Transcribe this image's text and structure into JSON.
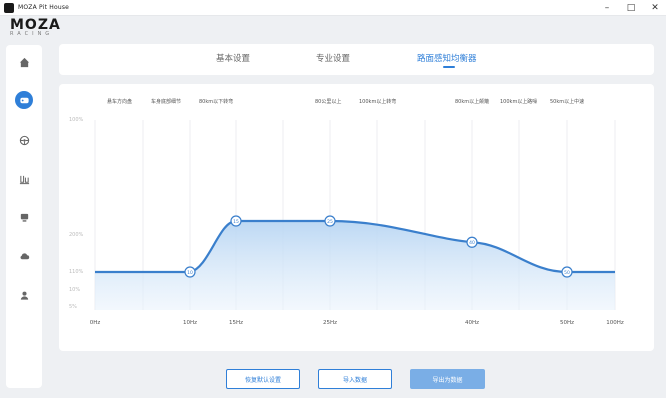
{
  "window": {
    "title": "MOZA Pit House",
    "minimize_glyph": "–",
    "maximize_glyph": "□",
    "close_glyph": "✕"
  },
  "logo": {
    "main": "MOZA",
    "sub": "RACING"
  },
  "sidebar": {
    "items": [
      {
        "icon": "home-icon"
      },
      {
        "icon": "wheelbase-icon",
        "active": true
      },
      {
        "icon": "steering-wheel-icon"
      },
      {
        "icon": "pedals-icon"
      },
      {
        "icon": "dashboard-icon"
      },
      {
        "icon": "cloud-icon"
      },
      {
        "icon": "user-icon"
      }
    ]
  },
  "tabs": [
    {
      "label": "基本设置"
    },
    {
      "label": "专业设置"
    },
    {
      "label": "路面感知均衡器",
      "active": true
    }
  ],
  "accent_color": "#2f7fd8",
  "chart_data": {
    "type": "area",
    "x": [
      "0Hz",
      "10Hz",
      "15Hz",
      "25Hz",
      "40Hz",
      "50Hz",
      "100Hz"
    ],
    "y_ticks": [
      "100%",
      "200%",
      "110%",
      "10%",
      "5%"
    ],
    "annotations_left": [
      "悬车方向盘",
      "车身底部细节",
      "80km以下转弯"
    ],
    "annotations_mid": [
      "80公里以上",
      "100km以上转弯"
    ],
    "annotations_right": [
      "80km以上颠簸",
      "100km以上路噪",
      "50km以上中速"
    ],
    "points": [
      {
        "x": "10Hz",
        "label": "10",
        "value": 40
      },
      {
        "x": "15Hz",
        "label": "15",
        "value": 100
      },
      {
        "x": "25Hz",
        "label": "25",
        "value": 100
      },
      {
        "x": "40Hz",
        "label": "40",
        "value": 75
      },
      {
        "x": "50Hz",
        "label": "50",
        "value": 40
      }
    ],
    "fill_color": "#cfe3f7",
    "line_color": "#3a7fcc"
  },
  "buttons": {
    "restore": "恢复默认设置",
    "import": "导入数据",
    "export": "导出为数据"
  }
}
